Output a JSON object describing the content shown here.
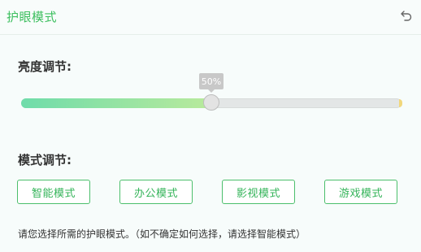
{
  "header": {
    "title": "护眼模式",
    "back_icon": "undo-arrow-icon"
  },
  "brightness": {
    "label": "亮度调节:",
    "value_text": "50%",
    "value": 0.5,
    "fill_colors": [
      "#6fdcaa",
      "#b9ea9c"
    ]
  },
  "modes": {
    "label": "模式调节:",
    "buttons": [
      "智能模式",
      "办公模式",
      "影视模式",
      "游戏模式"
    ],
    "accent_color": "#3dbf5f"
  },
  "hint": "请您选择所需的护眼模式。（如不确定如何选择，请选择智能模式）"
}
